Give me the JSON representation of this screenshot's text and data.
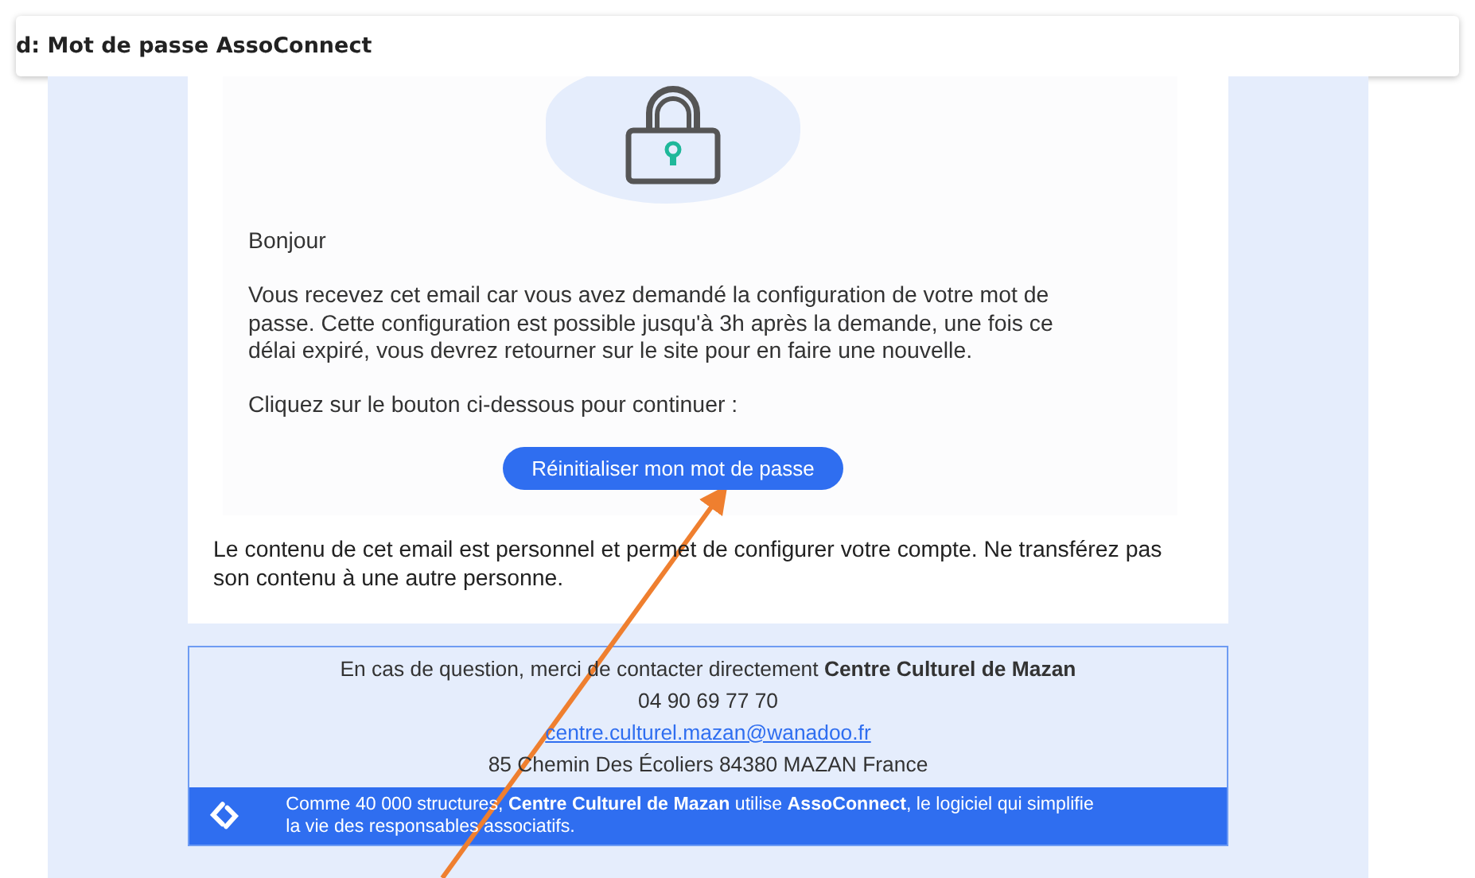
{
  "header": {
    "subject": "d: Mot de passe AssoConnect"
  },
  "email": {
    "greeting": "Bonjour",
    "paragraphs": [
      "Vous recevez cet email car vous avez demandé la configuration de votre mot de passe. Cette configuration est possible jusqu'à 3h après la demande, une fois ce délai expiré, vous devrez retourner sur le site pour en faire une nouvelle.",
      "Cliquez sur le bouton ci-dessous pour continuer :"
    ],
    "button": "Réinitialiser mon mot de passe",
    "notice": "Le contenu de cet email est personnel et permet de configurer votre compte. Ne transférez pas son contenu à une autre personne."
  },
  "contact": {
    "question": "En cas de question, merci de contacter directement **Centre Culturel de Mazan**",
    "phone": "04 90 69 77 70",
    "email": "centre.culturel.mazan@wanadoo.fr",
    "address": "85 Chemin Des Écoliers 84380 MAZAN France"
  },
  "banner": {
    "text": "Comme 40 000 structures, **Centre Culturel de Mazan** utilise **AssoConnect**, le logiciel qui simplifie la vie des responsables associatifs."
  }
}
